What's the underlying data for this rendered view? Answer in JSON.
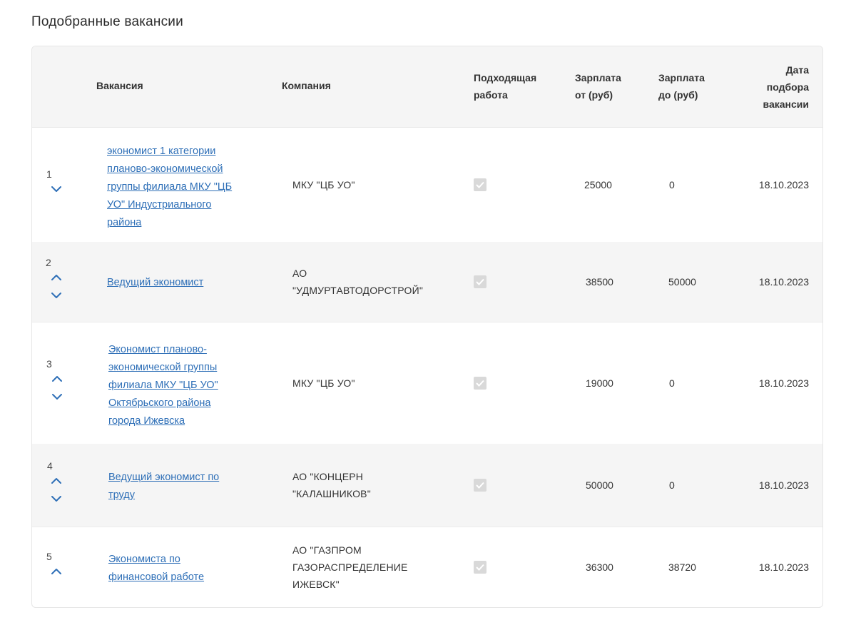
{
  "title": "Подобранные вакансии",
  "headers": {
    "vacancy": "Вакансия",
    "company": "Компания",
    "suitable_1": "Подходящая",
    "suitable_2": "работа",
    "salary_from_1": "Зарплата",
    "salary_from_2": "от (руб)",
    "salary_to_1": "Зарплата",
    "salary_to_2": "до (руб)",
    "date_1": "Дата",
    "date_2": "подбора",
    "date_3": "вакансии"
  },
  "rows": [
    {
      "num": "1",
      "vacancy_lines": [
        "экономист 1 категории",
        "планово-экономической",
        "группы филиала МКУ \"ЦБ",
        "УО\" Индустриального",
        "района"
      ],
      "company_lines": [
        "МКУ \"ЦБ УО\""
      ],
      "suitable": true,
      "salary_from": "25000",
      "salary_to": "0",
      "date": "18.10.2023"
    },
    {
      "num": "2",
      "vacancy_lines": [
        "Ведущий экономист"
      ],
      "company_lines": [
        "АО",
        "\"УДМУРТАВТОДОРСТРОЙ\""
      ],
      "suitable": true,
      "salary_from": "38500",
      "salary_to": "50000",
      "date": "18.10.2023"
    },
    {
      "num": "3",
      "vacancy_lines": [
        "Экономист планово-",
        "экономической группы",
        "филиала МКУ \"ЦБ УО\"",
        "Октябрьского района",
        "города Ижевска"
      ],
      "company_lines": [
        "МКУ \"ЦБ УО\""
      ],
      "suitable": true,
      "salary_from": "19000",
      "salary_to": "0",
      "date": "18.10.2023"
    },
    {
      "num": "4",
      "vacancy_lines": [
        "Ведущий экономист по",
        "труду"
      ],
      "company_lines": [
        "АО \"КОНЦЕРН",
        "\"КАЛАШНИКОВ\""
      ],
      "suitable": true,
      "salary_from": "50000",
      "salary_to": "0",
      "date": "18.10.2023"
    },
    {
      "num": "5",
      "vacancy_lines": [
        "Экономиста по",
        "финансовой работе"
      ],
      "company_lines": [
        "АО \"ГАЗПРОМ",
        "ГАЗОРАСПРЕДЕЛЕНИЕ",
        "ИЖЕВСК\""
      ],
      "suitable": true,
      "salary_from": "36300",
      "salary_to": "38720",
      "date": "18.10.2023"
    }
  ],
  "colors": {
    "link": "#2e6fb7",
    "arrow": "#2e6fb7",
    "row_alt": "#f5f5f5",
    "checkbox": "#d9d9d9"
  },
  "icons": {
    "up": "chevron-up-icon",
    "down": "chevron-down-icon",
    "check": "checkmark-icon"
  }
}
